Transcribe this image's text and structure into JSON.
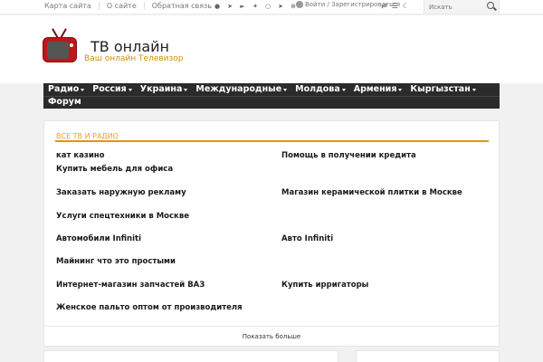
{
  "topbar": {
    "links": [
      "Карта сайта",
      "О сайте",
      "Обратная связь"
    ],
    "social_icons": [
      "facebook-icon",
      "twitter-icon",
      "vk-icon",
      "ok-icon",
      "odnoklassniki-icon",
      "telegram-icon",
      "rss-icon"
    ],
    "login_text": "Войти / Зарегистрироваться",
    "search_placeholder": "Искать"
  },
  "header": {
    "title": "ТВ онлайн",
    "description": "Ваш онлайн Телевизор",
    "accent_color": "#d68a0e"
  },
  "nav": {
    "items": [
      "Радио",
      "Россия",
      "Украина",
      "Международные",
      "Молдова",
      "Армения",
      "Кыргызстан",
      "Форум"
    ]
  },
  "main": {
    "block_title": "Все ТВ и Радио",
    "links": [
      "кат казино",
      "Помощь в получении кредита",
      "Купить мебель для офиса",
      "Заказать наружную рекламу",
      "Магазин керамической плитки в Москве",
      "Услуги спецтехники в Москве",
      "Автомобили Infiniti",
      "Авто Infiniti",
      "Майнинг что это простыми",
      "Интернет-магазин запчастей ВАЗ",
      "Купить ирригаторы",
      "Женское пальто оптом от производителя"
    ],
    "show_more": "Показать больше"
  }
}
